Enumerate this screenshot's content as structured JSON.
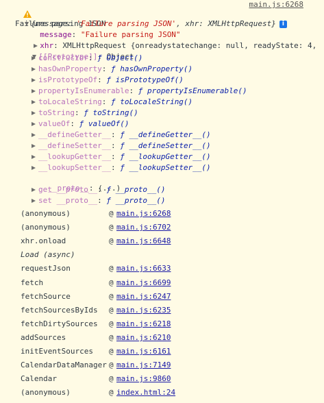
{
  "header": {
    "message": "Failure parsing JSON",
    "source_link": "main.js:6268"
  },
  "object_summary": {
    "text_a": "{message: ",
    "message_value": "'Failure parsing JSON'",
    "text_b": ", xhr: ",
    "xhr_value": "XMLHttpRequest",
    "text_c": "}",
    "badge": "i"
  },
  "props": {
    "message_key": "message",
    "message_value": "\"Failure parsing JSON\"",
    "xhr_key": "xhr",
    "xhr_value": "XMLHttpRequest {onreadystatechange: null, readyState: 4,",
    "prototype_key": "[[Prototype]]",
    "prototype_value": "Object"
  },
  "prototype_members": [
    {
      "key": "constructor",
      "fn": "Object()"
    },
    {
      "key": "hasOwnProperty",
      "fn": "hasOwnProperty()"
    },
    {
      "key": "isPrototypeOf",
      "fn": "isPrototypeOf()"
    },
    {
      "key": "propertyIsEnumerable",
      "fn": "propertyIsEnumerable()"
    },
    {
      "key": "toLocaleString",
      "fn": "toLocaleString()"
    },
    {
      "key": "toString",
      "fn": "toString()"
    },
    {
      "key": "valueOf",
      "fn": "valueOf()"
    },
    {
      "key": "__defineGetter__",
      "fn": "__defineGetter__()"
    },
    {
      "key": "__defineSetter__",
      "fn": "__defineSetter__()"
    },
    {
      "key": "__lookupGetter__",
      "fn": "__lookupGetter__()"
    },
    {
      "key": "__lookupSetter__",
      "fn": "__lookupSetter__()"
    }
  ],
  "proto_line": {
    "key": "__proto__",
    "value": "(...)"
  },
  "accessors": [
    {
      "key": "get __proto__",
      "fn": "__proto__()"
    },
    {
      "key": "set __proto__",
      "fn": "__proto__()"
    }
  ],
  "fn_symbol": "ƒ",
  "at_symbol": "@",
  "stack": [
    {
      "name": "(anonymous)",
      "link": "main.js:6268"
    },
    {
      "name": "(anonymous)",
      "link": "main.js:6702"
    },
    {
      "name": "xhr.onload",
      "link": "main.js:6648"
    },
    {
      "name": "Load (async)",
      "link": ""
    },
    {
      "name": "requestJson",
      "link": "main.js:6633"
    },
    {
      "name": "fetch",
      "link": "main.js:6699"
    },
    {
      "name": "fetchSource",
      "link": "main.js:6247"
    },
    {
      "name": "fetchSourcesByIds",
      "link": "main.js:6235"
    },
    {
      "name": "fetchDirtySources",
      "link": "main.js:6218"
    },
    {
      "name": "addSources",
      "link": "main.js:6210"
    },
    {
      "name": "initEventSources",
      "link": "main.js:6161"
    },
    {
      "name": "CalendarDataManager",
      "link": "main.js:7149"
    },
    {
      "name": "Calendar",
      "link": "main.js:9860"
    },
    {
      "name": "(anonymous)",
      "link": "index.html:24"
    }
  ],
  "colors": {
    "background": "#fffbe5",
    "key": "#881391",
    "string": "#c41a16",
    "link": "#1a1aa6",
    "warning": "#f2a600"
  }
}
